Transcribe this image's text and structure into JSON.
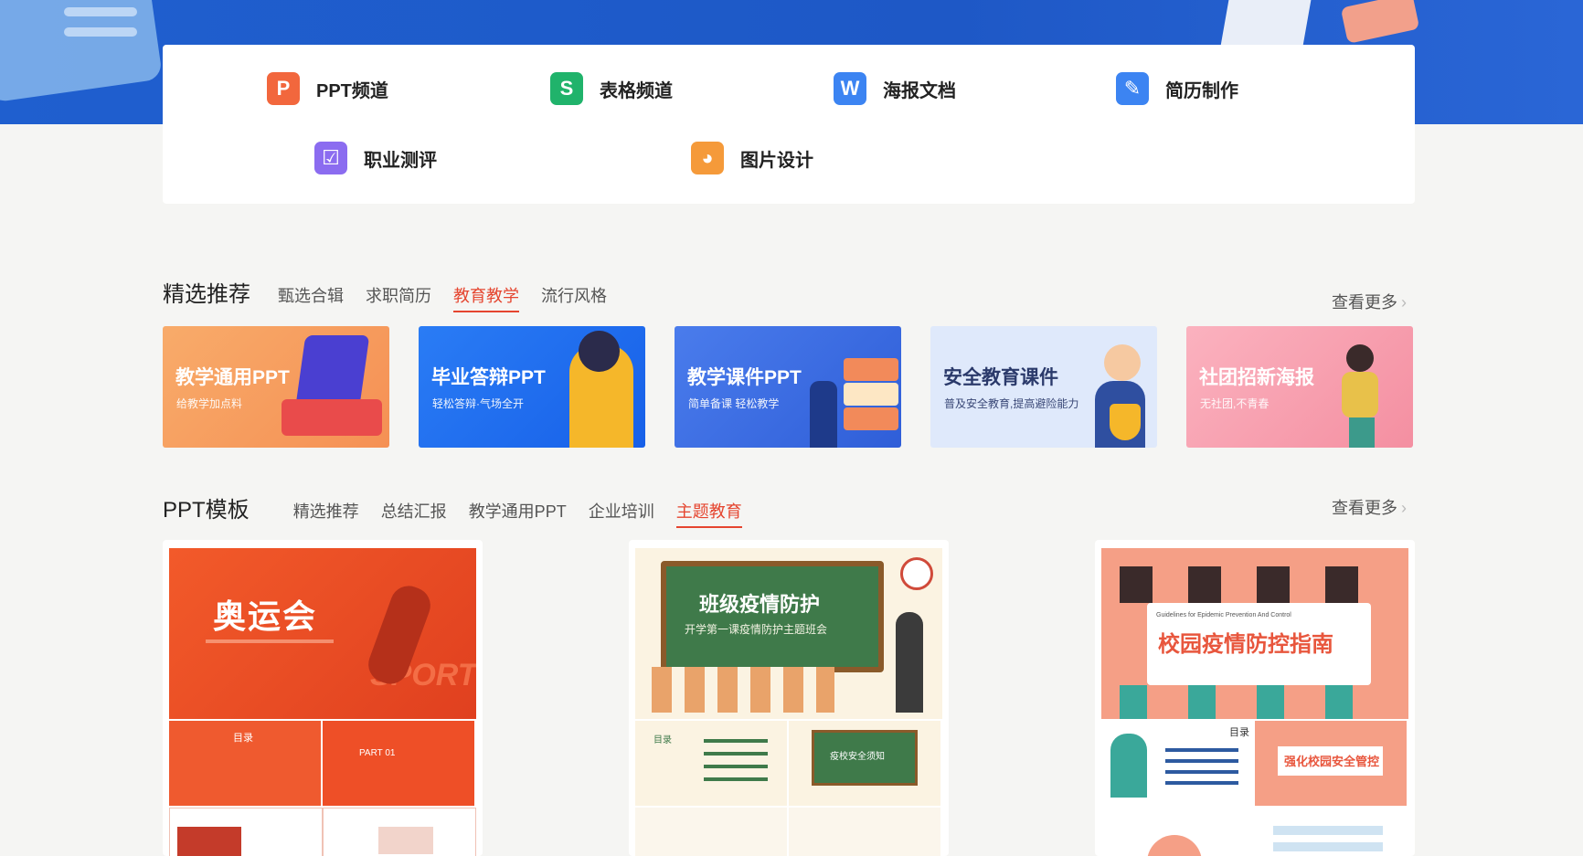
{
  "nav": {
    "items": [
      {
        "label": "PPT频道",
        "icon": "ppt-icon",
        "glyph": "P",
        "color": "#f2673d"
      },
      {
        "label": "表格频道",
        "icon": "spreadsheet-icon",
        "glyph": "S",
        "color": "#20b36b"
      },
      {
        "label": "海报文档",
        "icon": "word-doc-icon",
        "glyph": "W",
        "color": "#3c84f2"
      },
      {
        "label": "简历制作",
        "icon": "resume-icon",
        "glyph": "✎",
        "color": "#3c84f2"
      },
      {
        "label": "职业测评",
        "icon": "clipboard-check-icon",
        "glyph": "☑",
        "color": "#8b6cf0"
      },
      {
        "label": "图片设计",
        "icon": "palette-icon",
        "glyph": "◕",
        "color": "#f59a3a"
      }
    ]
  },
  "featured": {
    "title": "精选推荐",
    "tabs": [
      "甄选合辑",
      "求职简历",
      "教育教学",
      "流行风格"
    ],
    "active_tab": "教育教学",
    "more": "查看更多",
    "banners": [
      {
        "title": "教学通用PPT",
        "subtitle": "给教学加点料",
        "bg": "#f7a25e"
      },
      {
        "title": "毕业答辩PPT",
        "subtitle": "轻松答辩·气场全开",
        "bg": "#1f6ff0"
      },
      {
        "title": "教学课件PPT",
        "subtitle": "简单备课 轻松教学",
        "bg": "#3d6fe8"
      },
      {
        "title": "安全教育课件",
        "subtitle": "普及安全教育,提高避险能力",
        "bg": "#dfe9fb"
      },
      {
        "title": "社团招新海报",
        "subtitle": "无社团,不青春",
        "bg": "#f7a7b4"
      }
    ]
  },
  "ppt": {
    "title": "PPT模板",
    "tabs": [
      "精选推荐",
      "总结汇报",
      "教学通用PPT",
      "企业培训",
      "主题教育"
    ],
    "active_tab": "主题教育",
    "more": "查看更多",
    "cards": [
      {
        "headline": "奥运会",
        "sub": "SPORT",
        "thumbs": [
          "目录",
          "PART 01",
          "",
          ""
        ]
      },
      {
        "headline": "班级疫情防护",
        "sub": "开学第一课疫情防护主题班会",
        "thumbs": [
          "目录",
          "疫校安全须知",
          "",
          ""
        ]
      },
      {
        "headline": "校园疫情防控指南",
        "sub": "Guidelines for Epidemic Prevention And Control",
        "thumbs": [
          "目录",
          "强化校园安全管控",
          "",
          ""
        ]
      }
    ]
  }
}
